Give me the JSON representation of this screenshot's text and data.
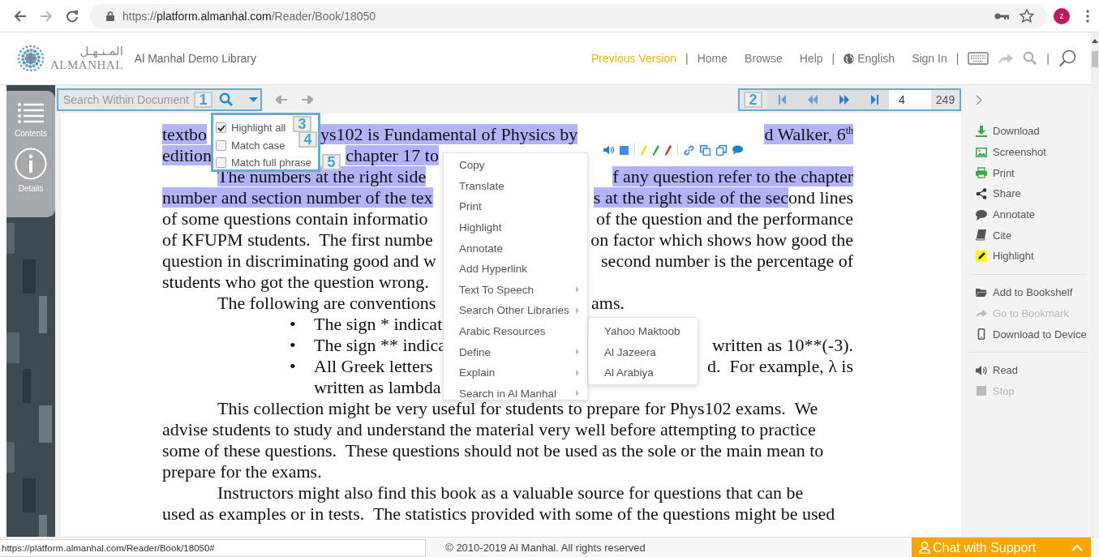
{
  "browser": {
    "url_scheme": "https://",
    "url_host": "platform.almanhal.com",
    "url_path": "/Reader/Book/18050",
    "profile_initial": "z"
  },
  "header": {
    "logo_arabic": "المـنـهـل",
    "logo_latin": "ALMANHAL",
    "library": "Al Manhal Demo Library",
    "nav": [
      {
        "kind": "highlight",
        "label": "Previous Version"
      },
      {
        "kind": "separator",
        "label": "|"
      },
      {
        "kind": "link",
        "label": "Home"
      },
      {
        "kind": "link",
        "label": "Browse"
      },
      {
        "kind": "link",
        "label": "Help"
      },
      {
        "kind": "separator",
        "label": "|"
      },
      {
        "kind": "language",
        "label": "English"
      },
      {
        "kind": "link",
        "label": "Sign In"
      },
      {
        "kind": "separator",
        "label": "|"
      },
      {
        "kind": "keyboard"
      },
      {
        "kind": "share"
      },
      {
        "kind": "search"
      },
      {
        "kind": "separator",
        "label": "|"
      },
      {
        "kind": "search-large"
      }
    ]
  },
  "side_tabs": [
    {
      "kind": "contents",
      "label": "Contents"
    },
    {
      "kind": "details",
      "label": "Details"
    }
  ],
  "search": {
    "placeholder": "Search Within Document",
    "badge": "1",
    "options": [
      {
        "label": "Highlight all",
        "checked": true,
        "badge": "3"
      },
      {
        "label": "Match case",
        "checked": false,
        "badge": "4"
      },
      {
        "label": "Match full phrase",
        "checked": false,
        "badge": "5"
      }
    ]
  },
  "pager": {
    "badge": "2",
    "page": "4",
    "total": "249"
  },
  "document": {
    "lines": [
      {
        "kind": "text",
        "start": [
          {
            "text": "textbo",
            "highlighted": true
          }
        ],
        "after_popup": [
          {
            "text": "ys102 is Fundamental of Physics by",
            "highlighted": true
          }
        ],
        "end": [
          {
            "text": "d Walker, 6$^{th}$",
            "highlighted": true
          }
        ]
      },
      {
        "kind": "text",
        "start": [
          {
            "text": "edition",
            "highlighted": true
          }
        ],
        "before_menu": [
          {
            "text": "chapter 17 to",
            "highlighted": true
          }
        ]
      },
      {
        "kind": "indent",
        "start": [
          {
            "text": "The numbers at the right side",
            "highlighted": true
          }
        ],
        "end": [
          {
            "text": "f any question refer to the chapter",
            "highlighted": true
          }
        ]
      },
      {
        "kind": "text",
        "start": [
          {
            "text": "number and section number of the tex",
            "highlighted": true
          }
        ],
        "end": [
          {
            "text": "s at the right side of the sec",
            "highlighted": true
          },
          {
            "text": "ond lines",
            "highlighted": false
          }
        ]
      },
      {
        "kind": "text",
        "start": [
          {
            "text": "of some questions contain informatio",
            "highlighted": false
          }
        ],
        "end": [
          {
            "text": "of the question and the performance",
            "highlighted": false
          }
        ]
      },
      {
        "kind": "text",
        "start": [
          {
            "text": "of KFUPM students.  The first numbe",
            "highlighted": false
          }
        ],
        "end": [
          {
            "text": "on factor which shows how good the",
            "highlighted": false
          }
        ]
      },
      {
        "kind": "text",
        "start": [
          {
            "text": "question in discriminating good and w",
            "highlighted": false
          }
        ],
        "end": [
          {
            "text": "second number is the percentage of",
            "highlighted": false
          }
        ]
      },
      {
        "kind": "text",
        "start": [
          {
            "text": "students who got the question wrong.",
            "highlighted": false
          }
        ]
      },
      {
        "kind": "indent",
        "start": [
          {
            "text": "The following are conventions",
            "highlighted": false
          }
        ],
        "after_menu": [
          {
            "text": "ams.",
            "highlighted": false
          }
        ]
      },
      {
        "kind": "bullet",
        "marker": "•",
        "start": [
          {
            "text": "The sign * indicat",
            "highlighted": false
          }
        ]
      },
      {
        "kind": "bullet",
        "marker": "•",
        "start": [
          {
            "text": "The sign ** indica",
            "highlighted": false
          }
        ],
        "end": [
          {
            "text": "written as 10**(-3).",
            "highlighted": false
          }
        ]
      },
      {
        "kind": "bullet",
        "marker": "•",
        "start": [
          {
            "text": "All Greek letters",
            "highlighted": false
          }
        ],
        "end": [
          {
            "text": "d.  For example, λ is",
            "highlighted": false
          }
        ]
      },
      {
        "kind": "bullet-cont",
        "start": [
          {
            "text": "written as lambda",
            "highlighted": false
          }
        ]
      },
      {
        "kind": "indent",
        "start": [
          {
            "text": "This collection might be very useful for students to prepare for Phys102 exams.  We",
            "highlighted": false
          }
        ]
      },
      {
        "kind": "text",
        "start": [
          {
            "text": "advise students to study and understand the material very well before attempting to practice",
            "highlighted": false
          }
        ]
      },
      {
        "kind": "text",
        "start": [
          {
            "text": "some of these questions.  These questions should not be used as the sole or the main mean to",
            "highlighted": false
          }
        ]
      },
      {
        "kind": "text",
        "start": [
          {
            "text": "prepare for the exams.",
            "highlighted": false
          }
        ]
      },
      {
        "kind": "indent",
        "start": [
          {
            "text": "Instructors might also find this book as a valuable source for questions that can be",
            "highlighted": false
          }
        ]
      },
      {
        "kind": "text",
        "start": [
          {
            "text": "used as examples or in tests.  The statistics provided with some of the questions might be used",
            "highlighted": false
          }
        ]
      }
    ]
  },
  "selection_toolbar": {
    "tool_groups": [
      [
        {
          "kind": "speak"
        },
        {
          "kind": "stop"
        }
      ],
      [
        {
          "kind": "pen",
          "color": "#f5df00"
        },
        {
          "kind": "pen",
          "color": "#2ca02c"
        },
        {
          "kind": "pen",
          "color": "#e02020"
        }
      ],
      [
        {
          "kind": "link"
        },
        {
          "kind": "copy"
        },
        {
          "kind": "copy-alt"
        },
        {
          "kind": "comment"
        }
      ]
    ]
  },
  "context_menu": {
    "items": [
      {
        "label": "Copy",
        "submenu": false
      },
      {
        "label": "Translate",
        "submenu": false
      },
      {
        "label": "Print",
        "submenu": false
      },
      {
        "label": "Highlight",
        "submenu": false
      },
      {
        "label": "Annotate",
        "submenu": false
      },
      {
        "label": "Add Hyperlink",
        "submenu": false
      },
      {
        "label": "Text To Speech",
        "submenu": true
      },
      {
        "label": "Search Other Libraries",
        "submenu": true
      },
      {
        "label": "Arabic Resources",
        "submenu": false
      },
      {
        "label": "Define",
        "submenu": true
      },
      {
        "label": "Explain",
        "submenu": true
      },
      {
        "label": "Search in Al Manhal",
        "submenu": true
      }
    ]
  },
  "submenu": {
    "items": [
      "Yahoo Maktoob",
      "Al Jazeera",
      "Al Arabiya"
    ]
  },
  "side_panel": {
    "groups": [
      [
        {
          "kind": "download",
          "label": "Download",
          "disabled": false
        },
        {
          "kind": "screenshot",
          "label": "Screenshot",
          "disabled": false
        },
        {
          "kind": "print",
          "label": "Print",
          "disabled": false
        },
        {
          "kind": "share",
          "label": "Share",
          "disabled": false
        },
        {
          "kind": "annotate",
          "label": "Annotate",
          "disabled": false
        },
        {
          "kind": "cite",
          "label": "Cite",
          "disabled": false
        },
        {
          "kind": "highlight",
          "label": "Highlight",
          "disabled": false
        }
      ],
      [
        {
          "kind": "bookshelf",
          "label": "Add to Bookshelf",
          "disabled": false
        },
        {
          "kind": "bookmark",
          "label": "Go to Bookmark",
          "disabled": true
        },
        {
          "kind": "device",
          "label": "Download to Device",
          "disabled": false
        }
      ],
      [
        {
          "kind": "read",
          "label": "Read",
          "disabled": false
        },
        {
          "kind": "stop",
          "label": "Stop",
          "disabled": true
        }
      ]
    ]
  },
  "footer": {
    "status_url": "https://platform.almanhal.com/Reader/Book/18050#",
    "copyright": "© 2010-2019 Al Manhal. All rights reserved",
    "chat": "Chat with Support"
  }
}
